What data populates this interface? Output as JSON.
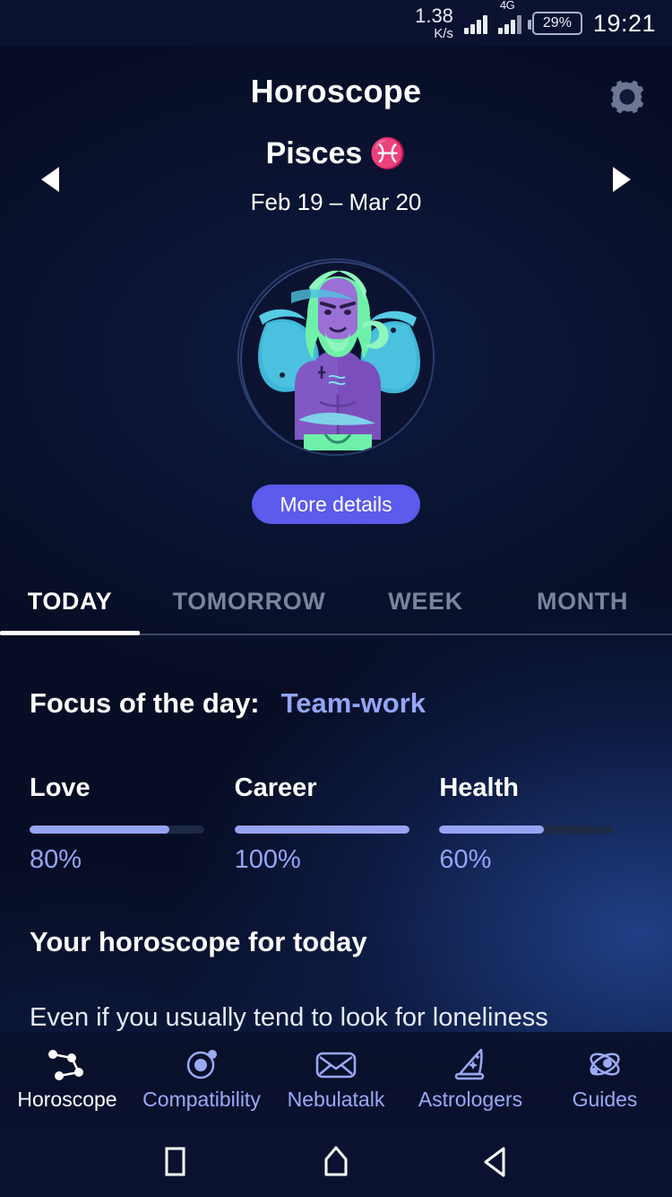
{
  "status_bar": {
    "net_rate_value": "1.38",
    "net_rate_unit": "K/s",
    "network_type": "4G",
    "battery": "29%",
    "clock": "19:21"
  },
  "header": {
    "title": "Horoscope",
    "settings_icon": "gear-icon",
    "prev_icon": "arrow-left-icon",
    "next_icon": "arrow-right-icon",
    "sign_name": "Pisces",
    "sign_glyph": "♓",
    "sign_dates": "Feb 19 – Mar 20",
    "more_details_label": "More details"
  },
  "tabs": [
    {
      "label": "TODAY",
      "active": true
    },
    {
      "label": "TOMORROW",
      "active": false
    },
    {
      "label": "WEEK",
      "active": false
    },
    {
      "label": "MONTH",
      "active": false
    }
  ],
  "content": {
    "focus_label": "Focus of the day:",
    "focus_value": "Team-work",
    "metrics": [
      {
        "name": "Love",
        "percent": "80%",
        "value": 80
      },
      {
        "name": "Career",
        "percent": "100%",
        "value": 100
      },
      {
        "name": "Health",
        "percent": "60%",
        "value": 60
      }
    ],
    "section_title": "Your horoscope for today",
    "body_text": "Even if you usually tend to look for loneliness"
  },
  "bottom_nav": [
    {
      "label": "Horoscope",
      "icon": "constellation-icon",
      "active": true
    },
    {
      "label": "Compatibility",
      "icon": "orbit-icon",
      "active": false
    },
    {
      "label": "Nebulatalk",
      "icon": "envelope-icon",
      "active": false
    },
    {
      "label": "Astrologers",
      "icon": "wizard-hat-icon",
      "active": false
    },
    {
      "label": "Guides",
      "icon": "atom-icon",
      "active": false
    }
  ],
  "system_nav": [
    {
      "label": "recents",
      "icon": "square-icon"
    },
    {
      "label": "home",
      "icon": "home-icon"
    },
    {
      "label": "back",
      "icon": "back-triangle-icon"
    }
  ],
  "colors": {
    "accent": "#5b5bec",
    "accent_light": "#94a5f7",
    "bar_fill": "#97a4f2",
    "bar_track": "#1d2a46",
    "background": "#0a1030"
  }
}
